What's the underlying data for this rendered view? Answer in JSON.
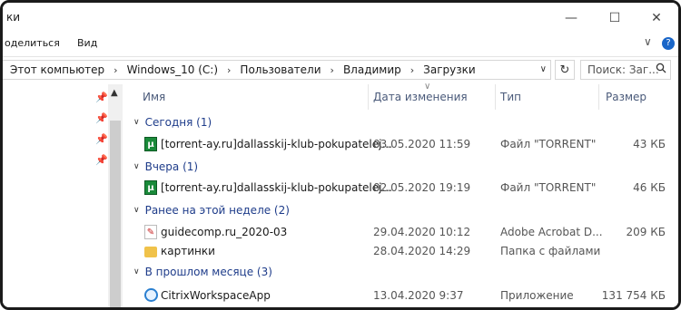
{
  "window": {
    "title": "ки",
    "controls": {
      "minimize": "—",
      "maximize": "☐",
      "close": "✕"
    }
  },
  "ribbon": {
    "share": "оделиться",
    "view": "Вид",
    "expand_chevron": "∨",
    "help": "?"
  },
  "address": {
    "crumbs": [
      "Этот компьютер",
      "Windows_10 (C:)",
      "Пользователи",
      "Владимир",
      "Загрузки"
    ],
    "separator": "›",
    "dropdown": "∨",
    "refresh": "↻",
    "search_placeholder": "Поиск: Заг..."
  },
  "columns": {
    "name": "Имя",
    "date": "Дата изменения",
    "type": "Тип",
    "size": "Размер"
  },
  "groups": [
    {
      "label": "Сегодня (1)",
      "chevron": "∨",
      "items": [
        {
          "name": "[torrent-ay.ru]dallasskij-klub-pokupatelej...",
          "date": "03.05.2020 11:59",
          "type": "Файл \"TORRENT\"",
          "size": "43 КБ",
          "icon": "torrent-icon"
        }
      ]
    },
    {
      "label": "Вчера (1)",
      "chevron": "∨",
      "items": [
        {
          "name": "[torrent-ay.ru]dallasskij-klub-pokupatelej...",
          "date": "02.05.2020 19:19",
          "type": "Файл \"TORRENT\"",
          "size": "46 КБ",
          "icon": "torrent-icon"
        }
      ]
    },
    {
      "label": "Ранее на этой неделе (2)",
      "chevron": "∨",
      "items": [
        {
          "name": "guidecomp.ru_2020-03",
          "date": "29.04.2020 10:12",
          "type": "Adobe Acrobat D...",
          "size": "209 КБ",
          "icon": "pdf-icon"
        },
        {
          "name": "картинки",
          "date": "28.04.2020 14:29",
          "type": "Папка с файлами",
          "size": "",
          "icon": "folder-icon"
        }
      ]
    },
    {
      "label": "В прошлом месяце (3)",
      "chevron": "∨",
      "items": [
        {
          "name": "CitrixWorkspaceApp",
          "date": "13.04.2020 9:37",
          "type": "Приложение",
          "size": "131 754 КБ",
          "icon": "citrix-icon"
        }
      ]
    }
  ]
}
